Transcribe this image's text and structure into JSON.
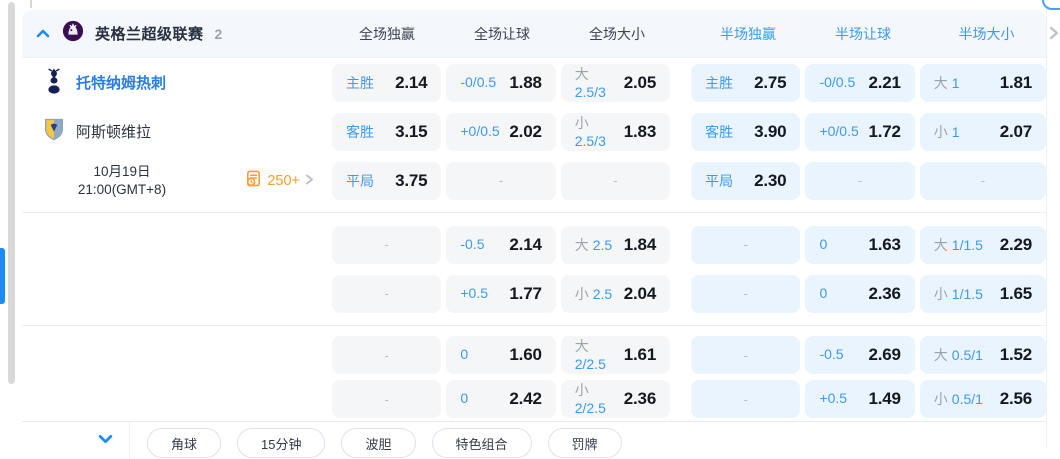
{
  "league": {
    "name": "英格兰超级联赛",
    "count": "2"
  },
  "columns": [
    {
      "label": "全场独赢",
      "period": "full"
    },
    {
      "label": "全场让球",
      "period": "full"
    },
    {
      "label": "全场大小",
      "period": "full"
    },
    {
      "label": "半场独赢",
      "period": "half"
    },
    {
      "label": "半场让球",
      "period": "half"
    },
    {
      "label": "半场大小",
      "period": "half"
    }
  ],
  "match": {
    "home": "托特纳姆热刺",
    "away": "阿斯顿维拉",
    "date": "10月19日",
    "time": "21:00(GMT+8)",
    "extra_markets": "250+"
  },
  "dash": "-",
  "odds_rows": [
    {
      "left": "home",
      "cells": [
        {
          "type": "outcome",
          "label": "主胜",
          "value": "2.14"
        },
        {
          "type": "handicap",
          "line": "-0/0.5",
          "value": "1.88"
        },
        {
          "type": "ou",
          "side": "大",
          "line": "2.5/3",
          "value": "2.05"
        },
        {
          "type": "outcome",
          "label": "主胜",
          "value": "2.75"
        },
        {
          "type": "handicap",
          "line": "-0/0.5",
          "value": "2.21"
        },
        {
          "type": "ou",
          "side": "大",
          "line": "1",
          "value": "1.81"
        }
      ]
    },
    {
      "left": "away",
      "cells": [
        {
          "type": "outcome",
          "label": "客胜",
          "value": "3.15"
        },
        {
          "type": "handicap",
          "line": "+0/0.5",
          "value": "2.02"
        },
        {
          "type": "ou",
          "side": "小",
          "line": "2.5/3",
          "value": "1.83"
        },
        {
          "type": "outcome",
          "label": "客胜",
          "value": "3.90"
        },
        {
          "type": "handicap",
          "line": "+0/0.5",
          "value": "1.72"
        },
        {
          "type": "ou",
          "side": "小",
          "line": "1",
          "value": "2.07"
        }
      ]
    },
    {
      "left": "datetime",
      "cells": [
        {
          "type": "outcome",
          "label": "平局",
          "value": "3.75"
        },
        {
          "type": "dash"
        },
        {
          "type": "dash"
        },
        {
          "type": "outcome",
          "label": "平局",
          "value": "2.30"
        },
        {
          "type": "dash"
        },
        {
          "type": "dash"
        }
      ]
    },
    {
      "left": "none",
      "cells": [
        {
          "type": "dash"
        },
        {
          "type": "handicap",
          "line": "-0.5",
          "value": "2.14"
        },
        {
          "type": "ou",
          "side": "大",
          "line": "2.5",
          "value": "1.84"
        },
        {
          "type": "dash"
        },
        {
          "type": "handicap",
          "line": "0",
          "value": "1.63"
        },
        {
          "type": "ou",
          "side": "大",
          "line": "1/1.5",
          "value": "2.29"
        }
      ]
    },
    {
      "left": "none",
      "cells": [
        {
          "type": "dash"
        },
        {
          "type": "handicap",
          "line": "+0.5",
          "value": "1.77"
        },
        {
          "type": "ou",
          "side": "小",
          "line": "2.5",
          "value": "2.04"
        },
        {
          "type": "dash"
        },
        {
          "type": "handicap",
          "line": "0",
          "value": "2.36"
        },
        {
          "type": "ou",
          "side": "小",
          "line": "1/1.5",
          "value": "1.65"
        }
      ]
    },
    {
      "left": "none",
      "cells": [
        {
          "type": "dash"
        },
        {
          "type": "handicap",
          "line": "0",
          "value": "1.60"
        },
        {
          "type": "ou",
          "side": "大",
          "line": "2/2.5",
          "value": "1.61"
        },
        {
          "type": "dash"
        },
        {
          "type": "handicap",
          "line": "-0.5",
          "value": "2.69"
        },
        {
          "type": "ou",
          "side": "大",
          "line": "0.5/1",
          "value": "1.52"
        }
      ]
    },
    {
      "left": "none",
      "cells": [
        {
          "type": "dash"
        },
        {
          "type": "handicap",
          "line": "0",
          "value": "2.42"
        },
        {
          "type": "ou",
          "side": "小",
          "line": "2/2.5",
          "value": "2.36"
        },
        {
          "type": "dash"
        },
        {
          "type": "handicap",
          "line": "+0.5",
          "value": "1.49"
        },
        {
          "type": "ou",
          "side": "小",
          "line": "0.5/1",
          "value": "2.56"
        }
      ]
    }
  ],
  "footer": {
    "buttons": [
      "角球",
      "15分钟",
      "波胆",
      "特色组合",
      "罚牌"
    ]
  },
  "icons": {
    "collapse": "chevron-up-icon",
    "expand": "chevron-down-icon",
    "more": "chevron-right-icon",
    "extra_markets": "markets-doc-icon",
    "league_logo": "premier-league-logo-icon",
    "home_crest": "tottenham-crest-icon",
    "away_crest": "aston-villa-crest-icon"
  },
  "colors": {
    "accent_blue": "#3d9af0",
    "halftime_cell_bg": "#e9f4fe",
    "fulltime_cell_bg": "#f5f6f8",
    "team_link_blue": "#2a7de1",
    "markets_orange": "#fb9d2b",
    "header_bg": "#f4f7fb"
  }
}
